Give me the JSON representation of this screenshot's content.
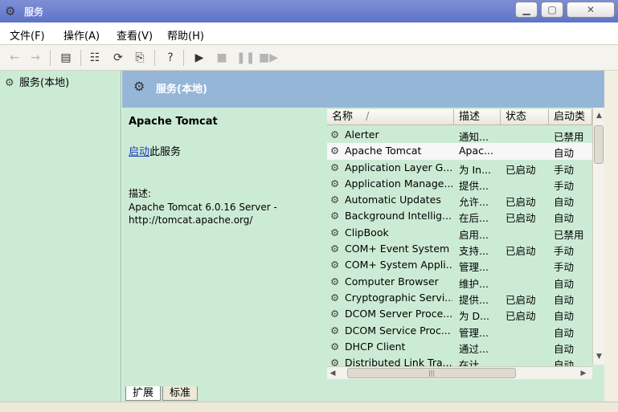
{
  "window": {
    "title": "服务"
  },
  "menu": [
    "文件(F)",
    "操作(A)",
    "查看(V)",
    "帮助(H)"
  ],
  "tree": {
    "root": "服务(本地)"
  },
  "header": {
    "title": "服务(本地)"
  },
  "details": {
    "service_name": "Apache Tomcat",
    "start_link": "启动",
    "start_suffix": "此服务",
    "desc_label": "描述:",
    "desc_text": "Apache Tomcat 6.0.16 Server - http://tomcat.apache.org/"
  },
  "columns": {
    "name": "名称",
    "desc": "描述",
    "state": "状态",
    "startup": "启动类"
  },
  "services": [
    {
      "name": "Alerter",
      "desc": "通知...",
      "state": "",
      "startup": "已禁用"
    },
    {
      "name": "Apache Tomcat",
      "desc": "Apac...",
      "state": "",
      "startup": "自动"
    },
    {
      "name": "Application Layer G...",
      "desc": "为 In...",
      "state": "已启动",
      "startup": "手动"
    },
    {
      "name": "Application Manage...",
      "desc": "提供...",
      "state": "",
      "startup": "手动"
    },
    {
      "name": "Automatic Updates",
      "desc": "允许...",
      "state": "已启动",
      "startup": "自动"
    },
    {
      "name": "Background Intellig...",
      "desc": "在后...",
      "state": "已启动",
      "startup": "自动"
    },
    {
      "name": "ClipBook",
      "desc": "启用...",
      "state": "",
      "startup": "已禁用"
    },
    {
      "name": "COM+ Event System",
      "desc": "支持...",
      "state": "已启动",
      "startup": "手动"
    },
    {
      "name": "COM+ System Appli...",
      "desc": "管理...",
      "state": "",
      "startup": "手动"
    },
    {
      "name": "Computer Browser",
      "desc": "维护...",
      "state": "",
      "startup": "自动"
    },
    {
      "name": "Cryptographic Servi...",
      "desc": "提供...",
      "state": "已启动",
      "startup": "自动"
    },
    {
      "name": "DCOM Server Proce...",
      "desc": "为 D...",
      "state": "已启动",
      "startup": "自动"
    },
    {
      "name": "DCOM Service Proc...",
      "desc": "管理...",
      "state": "",
      "startup": "自动"
    },
    {
      "name": "DHCP Client",
      "desc": "通过...",
      "state": "",
      "startup": "自动"
    },
    {
      "name": "Distributed Link Tra...",
      "desc": "在计...",
      "state": "",
      "startup": "自动"
    }
  ],
  "tabs": [
    "扩展",
    "标准"
  ],
  "icons": {
    "gear": "gear-icon",
    "back": "arrow-left-icon",
    "forward": "arrow-right-icon"
  },
  "colors": {
    "pane_bg": "#ccebd5",
    "header_bg": "#96b6d8",
    "link": "#1d39b8"
  }
}
